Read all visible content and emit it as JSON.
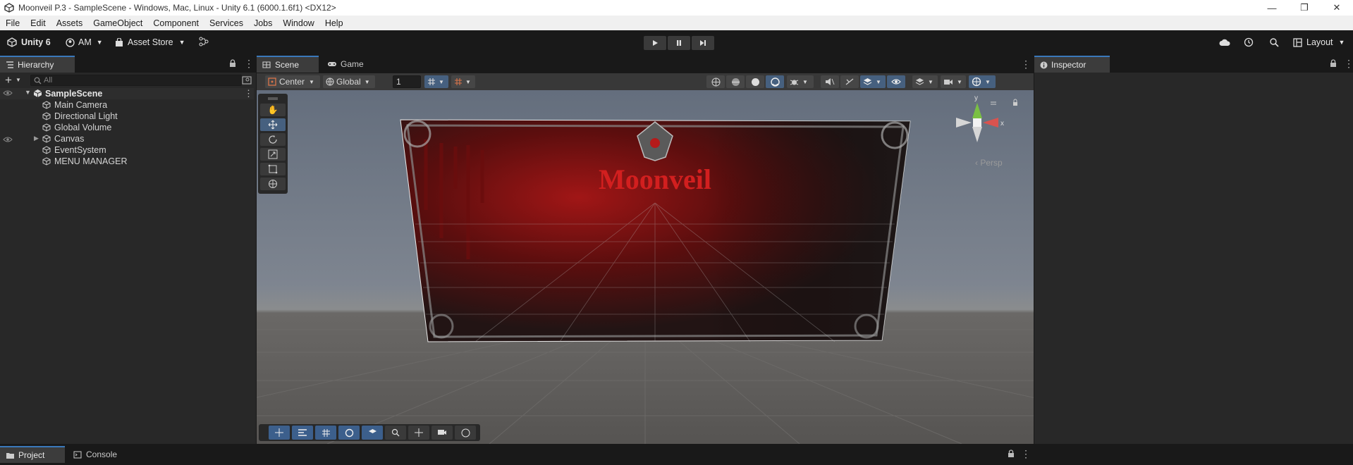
{
  "window": {
    "title": "Moonveil P.3 - SampleScene - Windows, Mac, Linux - Unity 6.1 (6000.1.6f1) <DX12>",
    "controls": [
      "—",
      "❐",
      "✕"
    ]
  },
  "menu": [
    "File",
    "Edit",
    "Assets",
    "GameObject",
    "Component",
    "Services",
    "Jobs",
    "Window",
    "Help"
  ],
  "toolbar": {
    "unity_label": "Unity 6",
    "account_label": "AM",
    "asset_store_label": "Asset Store",
    "layout_label": "Layout"
  },
  "hierarchy": {
    "tab_label": "Hierarchy",
    "search_placeholder": "All",
    "scene_name": "SampleScene",
    "items": [
      {
        "label": "Main Camera"
      },
      {
        "label": "Directional Light"
      },
      {
        "label": "Global Volume"
      },
      {
        "label": "Canvas"
      },
      {
        "label": "EventSystem"
      },
      {
        "label": "MENU MANAGER"
      }
    ]
  },
  "scene_view": {
    "tabs": [
      "Scene",
      "Game"
    ],
    "pivot_label": "Center",
    "space_label": "Global",
    "grid_value": "1",
    "persp_label": "Persp",
    "gizmo_axes": {
      "y": "y",
      "x": "x"
    },
    "canvas_title": "Moonveil"
  },
  "inspector": {
    "tab_label": "Inspector"
  },
  "bottom": {
    "tabs": [
      "Project",
      "Console"
    ]
  },
  "colors": {
    "accent": "#3a79bb",
    "title_red": "#d21f1f",
    "sky": "#5d6876",
    "ground": "#5a5856"
  }
}
